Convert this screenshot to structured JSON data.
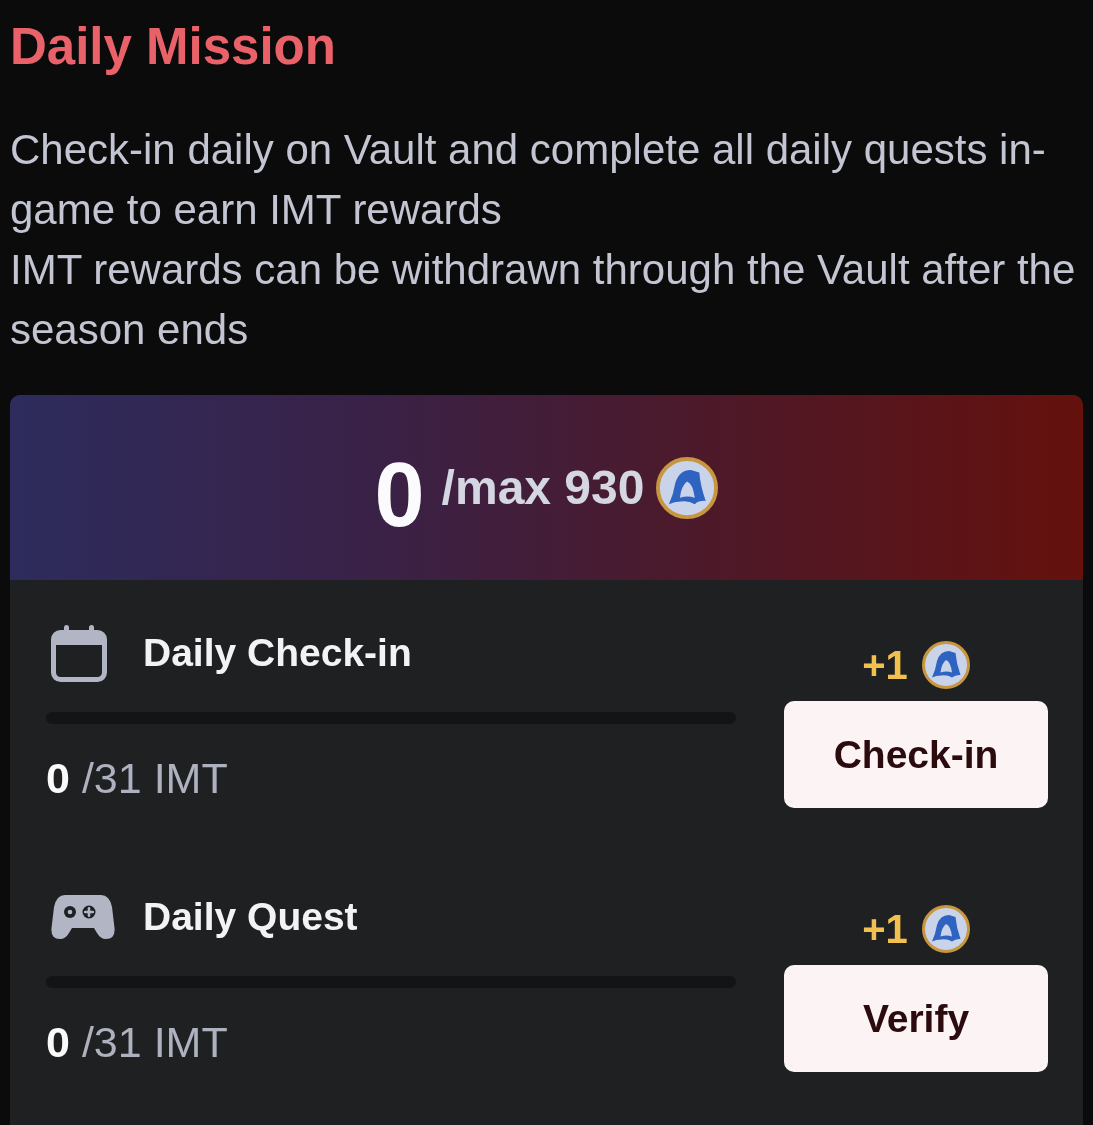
{
  "title": "Daily Mission",
  "description": [
    "Check-in daily on Vault and complete all daily quests in-game to earn IMT rewards",
    "IMT rewards can be withdrawn through the Vault after the season ends"
  ],
  "summary": {
    "earned": "0",
    "max": "/max 930"
  },
  "tasks": [
    {
      "kind": "checkin",
      "title": "Daily Check-in",
      "level": 0,
      "current": "0",
      "total": "/31 IMT",
      "reward": "+1",
      "button": "Check-in"
    },
    {
      "kind": "quest",
      "title": "Daily Quest",
      "level": 0,
      "current": "0",
      "total": "/31 IMT",
      "reward": "+1",
      "button": "Verify"
    }
  ]
}
